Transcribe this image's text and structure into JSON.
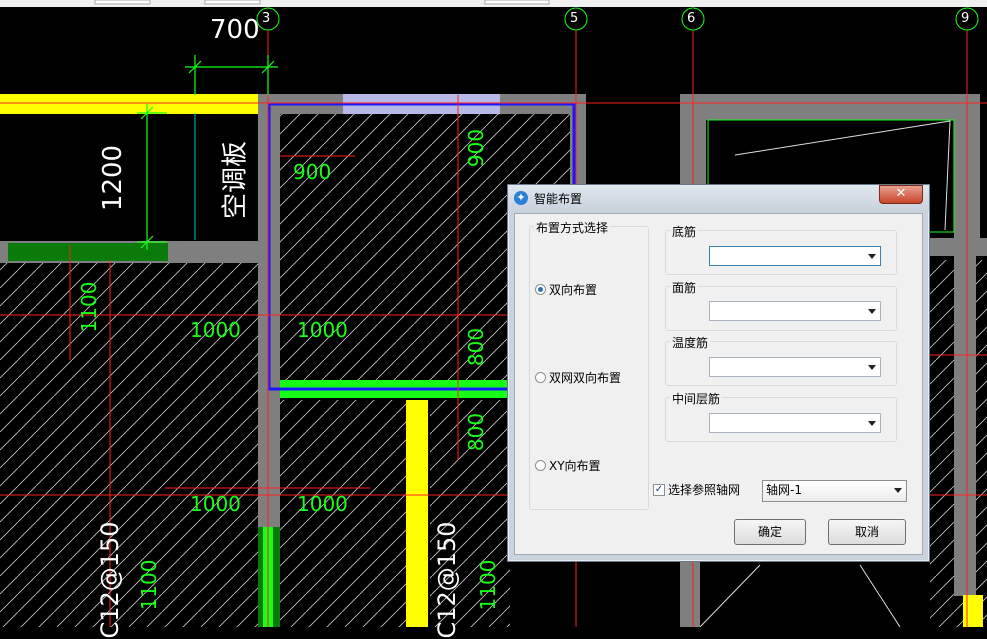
{
  "drawing": {
    "axis_labels": [
      "3",
      "5",
      "6",
      "9"
    ],
    "dim_700": "700",
    "dim_1200": "1200",
    "room_label": "空调板",
    "dims": {
      "d900_h": "900",
      "d900_v": "900",
      "d1100_a": "1100",
      "d1000_a": "1000",
      "d1000_b": "1000",
      "d800_a": "800",
      "d800_b": "800",
      "d1000_c": "1000",
      "d1000_d": "1000",
      "d1100_b": "1100",
      "d1100_c": "1100"
    },
    "rebar_a": "C12@150",
    "rebar_b": "C12@150",
    "colors": {
      "grid": "#ff2020",
      "wall": "#808080",
      "highlight": "#ffff00",
      "rebar": "#00ff00",
      "selection": "#1818ff",
      "text": "#ffffff"
    }
  },
  "dialog": {
    "title": "智能布置",
    "close_icon": "close-x-icon",
    "group_layout": {
      "label": "布置方式选择",
      "options": [
        {
          "label": "双向布置",
          "selected": true
        },
        {
          "label": "双网双向布置",
          "selected": false
        },
        {
          "label": "XY向布置",
          "selected": false
        }
      ]
    },
    "fields": [
      {
        "label": "底筋",
        "value": ""
      },
      {
        "label": "面筋",
        "value": ""
      },
      {
        "label": "温度筋",
        "value": ""
      },
      {
        "label": "中间层筋",
        "value": ""
      }
    ],
    "ref_axis_checkbox": {
      "label": "选择参照轴网",
      "checked": true
    },
    "axis_select": {
      "value": "轴网-1"
    },
    "ok_label": "确定",
    "cancel_label": "取消"
  }
}
